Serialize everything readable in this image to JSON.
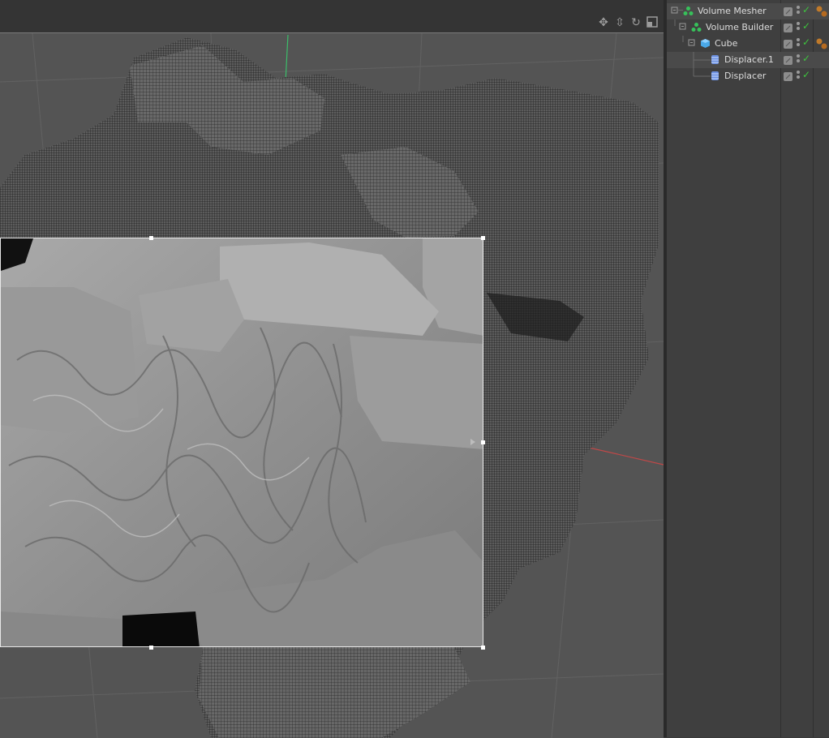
{
  "object_manager": {
    "objects": [
      {
        "name": "Volume Mesher",
        "icon": "volume-mesher-icon",
        "depth": 0,
        "enabled": true,
        "has_tag": true
      },
      {
        "name": "Volume Builder",
        "icon": "volume-builder-icon",
        "depth": 1,
        "enabled": true,
        "has_tag": false
      },
      {
        "name": "Cube",
        "icon": "cube-icon",
        "depth": 2,
        "enabled": true,
        "has_tag": true
      },
      {
        "name": "Displacer.1",
        "icon": "displacer-icon",
        "depth": 3,
        "enabled": true,
        "has_tag": false
      },
      {
        "name": "Displacer",
        "icon": "displacer-icon",
        "depth": 3,
        "enabled": true,
        "has_tag": false
      }
    ]
  },
  "viewport": {
    "nav_icons": [
      "move-icon",
      "zoom-icon",
      "rotate-icon",
      "maximize-icon"
    ],
    "colors": {
      "background": "#545454",
      "axis_x": "#c04848",
      "axis_y": "#3bbf6a",
      "region_border": "#e8e8e8"
    }
  }
}
